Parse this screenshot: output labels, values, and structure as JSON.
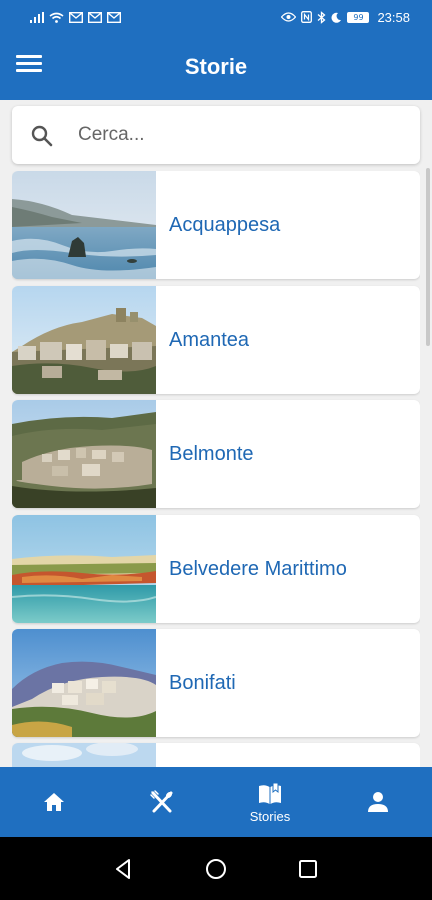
{
  "status_bar": {
    "time": "23:58",
    "battery": "99"
  },
  "app_bar": {
    "title": "Storie"
  },
  "search": {
    "placeholder": "Cerca..."
  },
  "stories": [
    {
      "name": "Acquappesa"
    },
    {
      "name": "Amantea"
    },
    {
      "name": "Belmonte"
    },
    {
      "name": "Belvedere Marittimo"
    },
    {
      "name": "Bonifati"
    }
  ],
  "bottom_nav": {
    "items": [
      {
        "icon": "home-icon",
        "label": ""
      },
      {
        "icon": "cutlery-icon",
        "label": ""
      },
      {
        "icon": "book-icon",
        "label": "Stories"
      },
      {
        "icon": "user-icon",
        "label": ""
      }
    ],
    "active": 2
  },
  "colors": {
    "primary": "#1f6fc0",
    "label": "#1f68b4",
    "background": "#f0f0f0"
  }
}
